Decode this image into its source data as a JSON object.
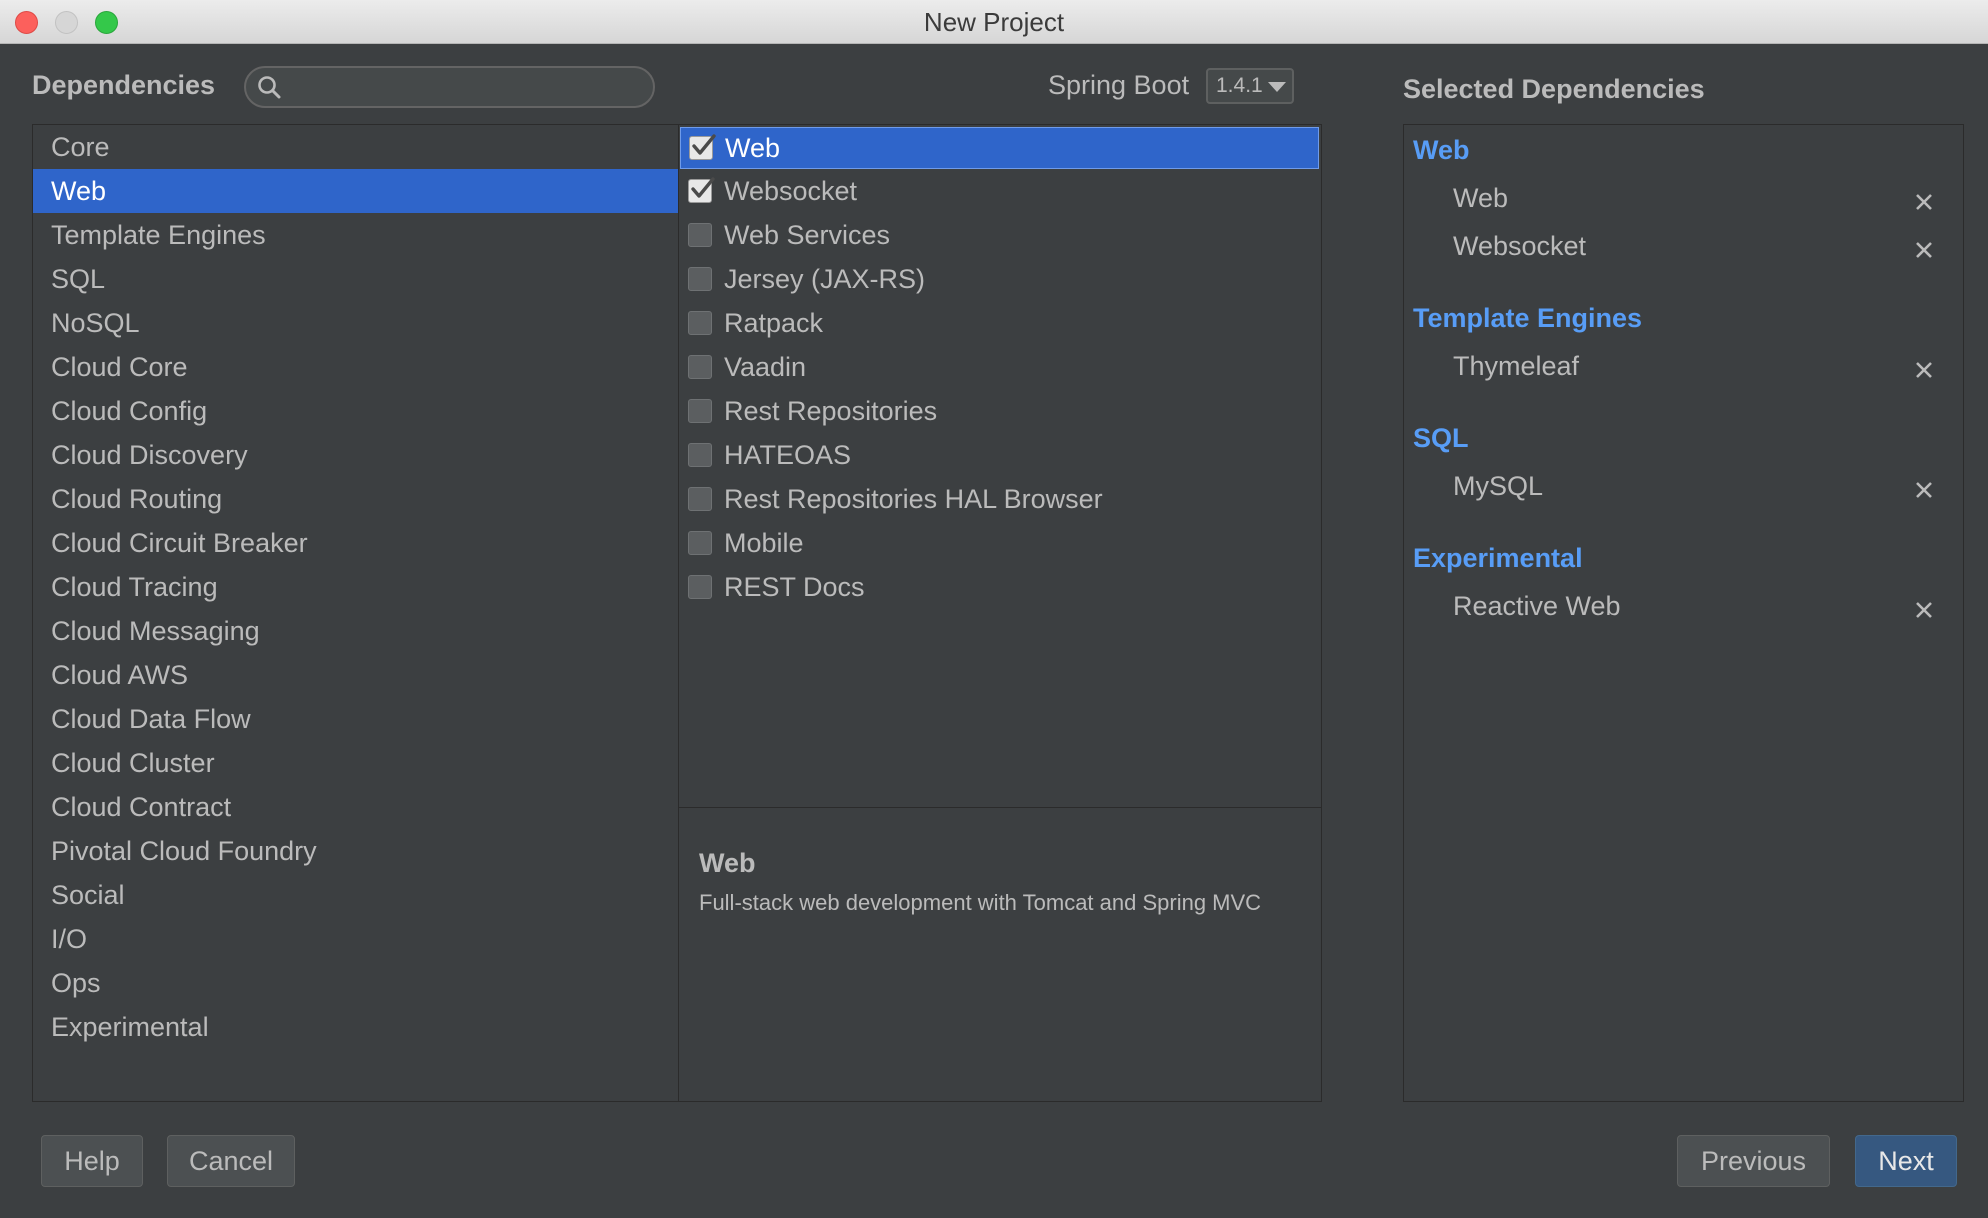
{
  "window": {
    "title": "New Project"
  },
  "header": {
    "dependencies_label": "Dependencies",
    "search_value": "",
    "spring_boot_label": "Spring Boot",
    "spring_boot_version": "1.4.1"
  },
  "categories": [
    {
      "label": "Core",
      "selected": false
    },
    {
      "label": "Web",
      "selected": true
    },
    {
      "label": "Template Engines",
      "selected": false
    },
    {
      "label": "SQL",
      "selected": false
    },
    {
      "label": "NoSQL",
      "selected": false
    },
    {
      "label": "Cloud Core",
      "selected": false
    },
    {
      "label": "Cloud Config",
      "selected": false
    },
    {
      "label": "Cloud Discovery",
      "selected": false
    },
    {
      "label": "Cloud Routing",
      "selected": false
    },
    {
      "label": "Cloud Circuit Breaker",
      "selected": false
    },
    {
      "label": "Cloud Tracing",
      "selected": false
    },
    {
      "label": "Cloud Messaging",
      "selected": false
    },
    {
      "label": "Cloud AWS",
      "selected": false
    },
    {
      "label": "Cloud Data Flow",
      "selected": false
    },
    {
      "label": "Cloud Cluster",
      "selected": false
    },
    {
      "label": "Cloud Contract",
      "selected": false
    },
    {
      "label": "Pivotal Cloud Foundry",
      "selected": false
    },
    {
      "label": "Social",
      "selected": false
    },
    {
      "label": "I/O",
      "selected": false
    },
    {
      "label": "Ops",
      "selected": false
    },
    {
      "label": "Experimental",
      "selected": false
    }
  ],
  "dependencies": [
    {
      "label": "Web",
      "checked": true,
      "highlighted": true
    },
    {
      "label": "Websocket",
      "checked": true,
      "highlighted": false
    },
    {
      "label": "Web Services",
      "checked": false,
      "highlighted": false
    },
    {
      "label": "Jersey (JAX-RS)",
      "checked": false,
      "highlighted": false
    },
    {
      "label": "Ratpack",
      "checked": false,
      "highlighted": false
    },
    {
      "label": "Vaadin",
      "checked": false,
      "highlighted": false
    },
    {
      "label": "Rest Repositories",
      "checked": false,
      "highlighted": false
    },
    {
      "label": "HATEOAS",
      "checked": false,
      "highlighted": false
    },
    {
      "label": "Rest Repositories HAL Browser",
      "checked": false,
      "highlighted": false
    },
    {
      "label": "Mobile",
      "checked": false,
      "highlighted": false
    },
    {
      "label": "REST Docs",
      "checked": false,
      "highlighted": false
    }
  ],
  "description": {
    "title": "Web",
    "text": "Full-stack web development with Tomcat and Spring MVC"
  },
  "selected": {
    "label": "Selected Dependencies",
    "groups": [
      {
        "title": "Web",
        "items": [
          "Web",
          "Websocket"
        ]
      },
      {
        "title": "Template Engines",
        "items": [
          "Thymeleaf"
        ]
      },
      {
        "title": "SQL",
        "items": [
          "MySQL"
        ]
      },
      {
        "title": "Experimental",
        "items": [
          "Reactive Web"
        ]
      }
    ]
  },
  "buttons": {
    "help": "Help",
    "cancel": "Cancel",
    "previous": "Previous",
    "next": "Next"
  },
  "colors": {
    "background": "#3c3f41",
    "selection": "#2f65ca",
    "group_title": "#589df6",
    "primary_button": "#365880"
  },
  "icons": {
    "search": "search-icon",
    "remove": "close-icon",
    "dropdown": "chevron-down-icon",
    "check": "check-icon"
  }
}
